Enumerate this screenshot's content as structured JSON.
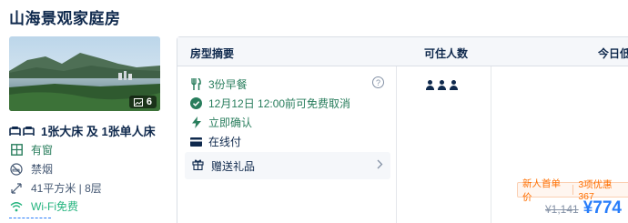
{
  "room": {
    "title": "山海景观家庭房",
    "photo_count": "6",
    "bed": "1张大床 及 1张单人床",
    "features": [
      {
        "icon": "window-icon",
        "label": "有窗"
      },
      {
        "icon": "no-smoking-icon",
        "label": "禁烟"
      },
      {
        "icon": "area-icon",
        "label": "41平方米 | 8层"
      },
      {
        "icon": "wifi-icon",
        "label": "Wi-Fi免费"
      }
    ]
  },
  "table": {
    "headers": [
      "房型摘要",
      "可住人数",
      "今日低"
    ],
    "perks": [
      {
        "icon": "breakfast-icon",
        "label": "3份早餐"
      },
      {
        "icon": "check-circle-icon",
        "label": "12月12日 12:00前可免费取消"
      },
      {
        "icon": "lightning-icon",
        "label": "立即确认"
      },
      {
        "icon": "card-icon",
        "label": "在线付"
      }
    ],
    "gift_label": "赠送礼品",
    "help_symbol": "?",
    "guests": 3,
    "promo": {
      "new_user": "新人首单价",
      "discount": "3项优惠367"
    },
    "old_price": "¥1,141",
    "new_price": "¥774"
  },
  "colors": {
    "accent": "#287dfa",
    "green": "#287d5c",
    "orange": "#ff6f00"
  }
}
